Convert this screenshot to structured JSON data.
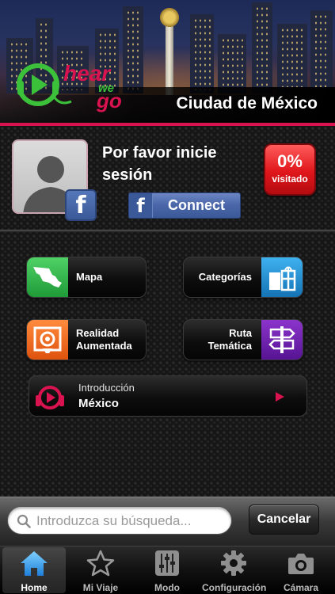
{
  "header": {
    "city_title": "Ciudad de México",
    "logo_text_top": "hear",
    "logo_text_mid": "we",
    "logo_text_bottom": "go"
  },
  "profile": {
    "login_prompt": "Por favor inicie sesión",
    "facebook_connect_label": "Connect",
    "visited_percent": "0%",
    "visited_label": "visitado"
  },
  "menu": {
    "mapa": "Mapa",
    "categorias": "Categorías",
    "realidad_aumentada": "Realidad Aumentada",
    "ruta_tematica": "Ruta Temática",
    "intro_small": "Introducción",
    "intro_big": "México"
  },
  "search": {
    "placeholder": "Introduzca su búsqueda...",
    "cancel_label": "Cancelar"
  },
  "tabs": [
    {
      "label": "Home",
      "icon": "home-icon"
    },
    {
      "label": "Mi Viaje",
      "icon": "star-icon"
    },
    {
      "label": "Modo",
      "icon": "sliders-icon"
    },
    {
      "label": "Configuración",
      "icon": "gear-icon"
    },
    {
      "label": "Cámara",
      "icon": "camera-icon"
    }
  ],
  "colors": {
    "brand_pink": "#d8134f",
    "brand_green": "#3cc13b",
    "facebook_blue": "#3b5998",
    "visited_red": "#e0161b",
    "mapa_green": "#2fb84a",
    "categorias_blue": "#1f8fd1",
    "realidad_orange": "#ef6a1e",
    "ruta_purple": "#6a1fa8"
  }
}
